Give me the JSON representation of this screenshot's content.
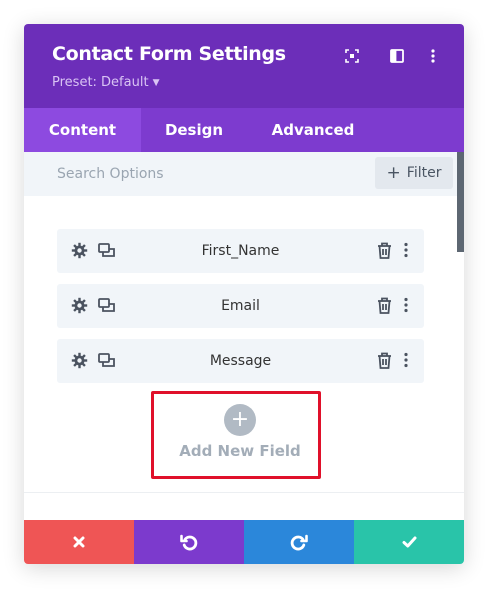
{
  "header": {
    "title": "Contact Form Settings",
    "preset_label": "Preset: Default",
    "bg_color": "#6c2eb9",
    "icons": [
      "focus-icon",
      "sidebar-icon",
      "more-vertical-icon"
    ]
  },
  "tabs": [
    {
      "label": "Content",
      "active": true
    },
    {
      "label": "Design",
      "active": false
    },
    {
      "label": "Advanced",
      "active": false
    }
  ],
  "search": {
    "placeholder": "Search Options",
    "value": ""
  },
  "filter": {
    "label": "Filter"
  },
  "fields": [
    {
      "label": "First_Name"
    },
    {
      "label": "Email"
    },
    {
      "label": "Message"
    }
  ],
  "add_field": {
    "label": "Add New Field",
    "symbol": "+"
  },
  "footer": {
    "buttons": [
      {
        "name": "cancel",
        "icon": "close-icon",
        "color": "#ef5555"
      },
      {
        "name": "undo",
        "icon": "undo-icon",
        "color": "#7c3acd"
      },
      {
        "name": "redo",
        "icon": "redo-icon",
        "color": "#2b87da"
      },
      {
        "name": "save",
        "icon": "check-icon",
        "color": "#29c4a9"
      }
    ]
  }
}
